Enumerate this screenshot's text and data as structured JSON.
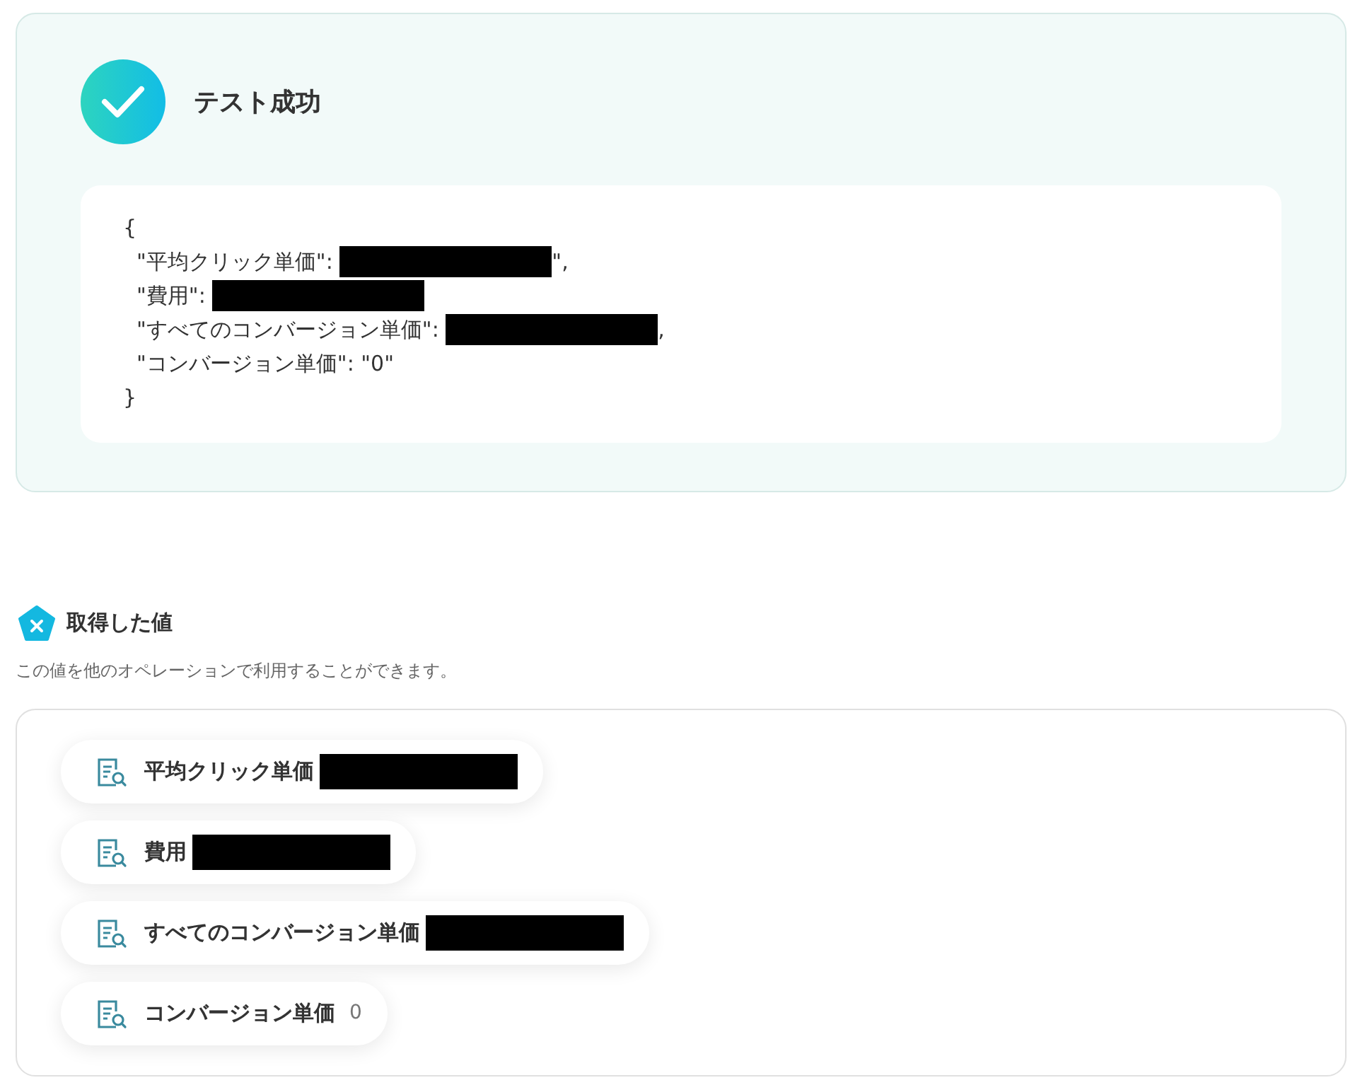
{
  "result": {
    "title": "テスト成功",
    "succeeded": true,
    "json_lines": [
      {
        "text": "{"
      },
      {
        "text": "  \"平均クリック単価\": ",
        "redacted": true,
        "tail": "\","
      },
      {
        "text": "  \"費用\": ",
        "redacted": true
      },
      {
        "text": "  \"すべてのコンバージョン単価\": ",
        "redacted": true,
        "tail": ","
      },
      {
        "text": "  \"コンバージョン単価\": \"0\""
      },
      {
        "text": "}"
      }
    ]
  },
  "values": {
    "title": "取得した値",
    "description": "この値を他のオペレーションで利用することができます。",
    "items": [
      {
        "label": "平均クリック単価",
        "redacted": true
      },
      {
        "label": "費用",
        "redacted": true
      },
      {
        "label": "すべてのコンバージョン単価",
        "redacted": true
      },
      {
        "label": "コンバージョン単価",
        "value": "0"
      }
    ]
  }
}
